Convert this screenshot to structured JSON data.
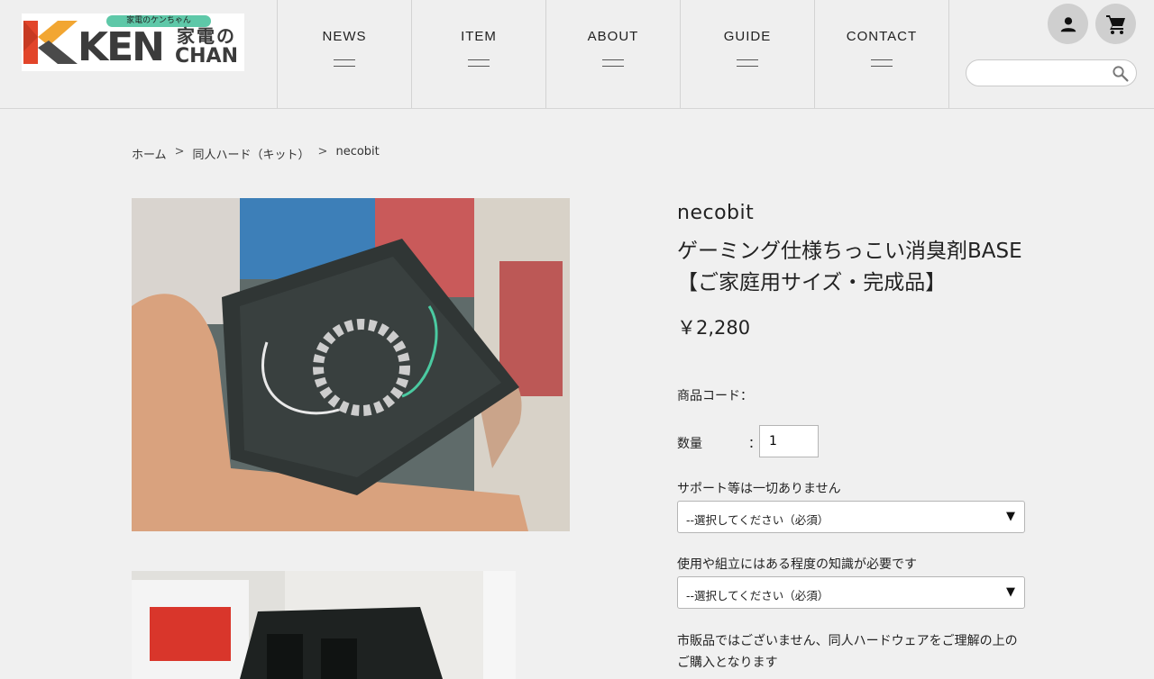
{
  "header": {
    "logo": {
      "tag": "家電のケンちゃん",
      "ken": "KEN",
      "kaden": "家電の",
      "chan": "CHAN"
    },
    "nav": [
      {
        "label": "NEWS"
      },
      {
        "label": "ITEM"
      },
      {
        "label": "ABOUT"
      },
      {
        "label": "GUIDE"
      },
      {
        "label": "CONTACT"
      }
    ],
    "search": {
      "value": "",
      "placeholder": ""
    }
  },
  "breadcrumb": {
    "home": "ホーム",
    "category": "同人ハード（キット）",
    "current": "necobit",
    "separator": ">"
  },
  "product": {
    "brand": "necobit",
    "title": "ゲーミング仕様ちっこい消臭剤BASE 【ご家庭用サイズ・完成品】",
    "price": "￥2,280",
    "code_label": "商品コード：",
    "quantity_label": "数量",
    "quantity_colon": "：",
    "quantity_value": "1",
    "options": [
      {
        "label": "サポート等は一切ありません",
        "selected": "--選択してください（必須）"
      },
      {
        "label": "使用や組立にはある程度の知識が必要です",
        "selected": "--選択してください（必須）"
      }
    ],
    "note": "市販品ではございません、同人ハードウェアをご理解の上のご購入となります"
  },
  "colors": {
    "background": "#f0f0f0",
    "logo_tag": "#5ec8a8",
    "logo_red": "#e2452a",
    "logo_orange": "#f2a632",
    "icon_circle": "#cfcfcf"
  }
}
